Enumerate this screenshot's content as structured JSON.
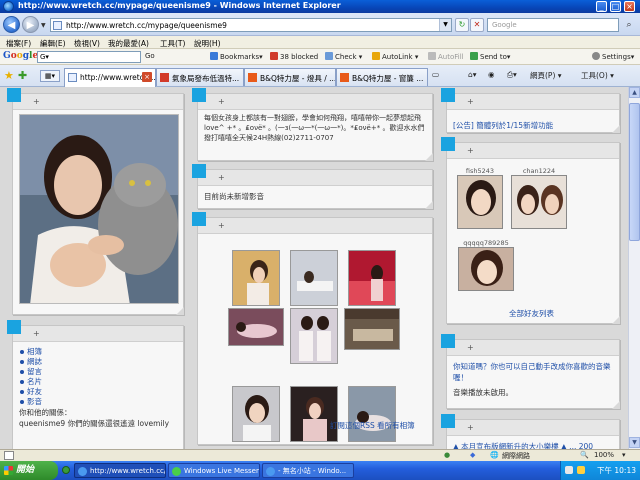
{
  "window": {
    "title": "http://www.wretch.cc/mypage/queenisme9 - Windows Internet Explorer",
    "min": "_",
    "max": "□",
    "close": "×"
  },
  "address": {
    "url": "http://www.wretch.cc/mypage/queenisme9",
    "search_placeholder": "Google"
  },
  "menu": [
    "檔案(F)",
    "編輯(E)",
    "檢視(V)",
    "我的最愛(A)",
    "工具(T)",
    "說明(H)"
  ],
  "google_toolbar": {
    "logo": "Google",
    "search_value": "G▾",
    "items": [
      "Go",
      "Bookmarks▾",
      "38 blocked",
      "Check ▾",
      "AutoLink ▾",
      "AutoFill",
      "Send to▾",
      "Settings▾"
    ]
  },
  "tabs": [
    {
      "label": "http://www.wretch...",
      "active": true
    },
    {
      "label": "氣象局發布低溫特...",
      "active": false
    },
    {
      "label": "B&Q特力屋 - 燈具 / ...",
      "active": false
    },
    {
      "label": "B&Q特力屋 - 窗簾 ...",
      "active": false
    }
  ],
  "commands": [
    "網頁(P) ▾",
    "工具(O) ▾"
  ],
  "panels": {
    "intro": {
      "text": "每個女孩身上都該有一對翅膀，學會如何飛翔，嘻嘻帶你一起夢想起飛love^ +* 。₤ονё* 。(一з(一ω一*(一ω一*)。*₤ονё+* 。歡迎水水們撥打嘻嘻全天候24H熱線(02)2711-0707"
    },
    "video": {
      "text": "目前尚未新增影音"
    },
    "album": {
      "link": "訂閱這個RSS  看所有相簿"
    },
    "notice": {
      "text": "[公告]  簡體列於1/15新增功能"
    },
    "friends": {
      "names": [
        "fish5243",
        "chan1224",
        "qqqqq789285"
      ],
      "all_link": "全部好友列表"
    },
    "music": {
      "question": "你知道嗎？你也可以自己動手改成你喜歡的音樂喔！",
      "status": "音樂播放未啟用。"
    },
    "nav": {
      "items": [
        "相簿",
        "網誌",
        "留言",
        "名片",
        "好友",
        "影音"
      ],
      "relation_label": "你和他的關係：",
      "relation_text": "queenisme9  你們的關係還很遙遠   lovemily"
    },
    "bottom_right": {
      "text": "▲ 本月宣布版網新升的大小樂樓 ▲ ... 200"
    }
  },
  "status_bar": {
    "zone": "網際網路",
    "zoom": "100%"
  },
  "taskbar": {
    "start": "開始",
    "buttons": [
      {
        "label": "http://www.wretch.cc/..."
      },
      {
        "label": "Windows Live Messen..."
      },
      {
        "label": "- 無名小站 - Windo..."
      }
    ],
    "clock": "下午 10:13"
  },
  "colors": {
    "accent": "#1aa3e0",
    "link": "#1f4fa8",
    "titlebar": "#0a5fd8"
  }
}
